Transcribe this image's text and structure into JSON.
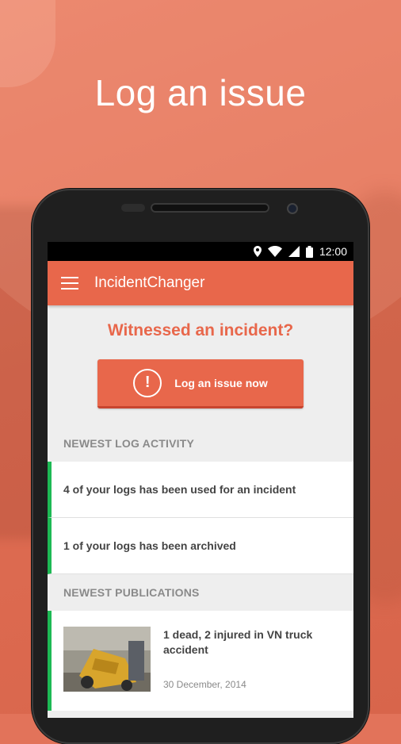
{
  "headline": "Log an issue",
  "status_bar": {
    "time": "12:00"
  },
  "app_bar": {
    "title": "IncidentChanger"
  },
  "hero": {
    "title": "Witnessed an incident?",
    "button_label": "Log an issue now",
    "button_icon_glyph": "!"
  },
  "log_activity": {
    "header": "NEWEST LOG ACTIVITY",
    "items": [
      {
        "text": "4 of your logs has been used for an incident"
      },
      {
        "text": "1 of your logs has been archived"
      }
    ]
  },
  "publications": {
    "header": "NEWEST PUBLICATIONS",
    "items": [
      {
        "title": "1 dead, 2 injured in VN truck accident",
        "date": "30 December, 2014"
      }
    ]
  },
  "colors": {
    "brand": "#e8674b",
    "accent_green": "#1db954",
    "background": "#eeeeee"
  },
  "icons": [
    "menu-icon",
    "location-icon",
    "wifi-icon",
    "signal-icon",
    "battery-icon",
    "alert-icon"
  ]
}
